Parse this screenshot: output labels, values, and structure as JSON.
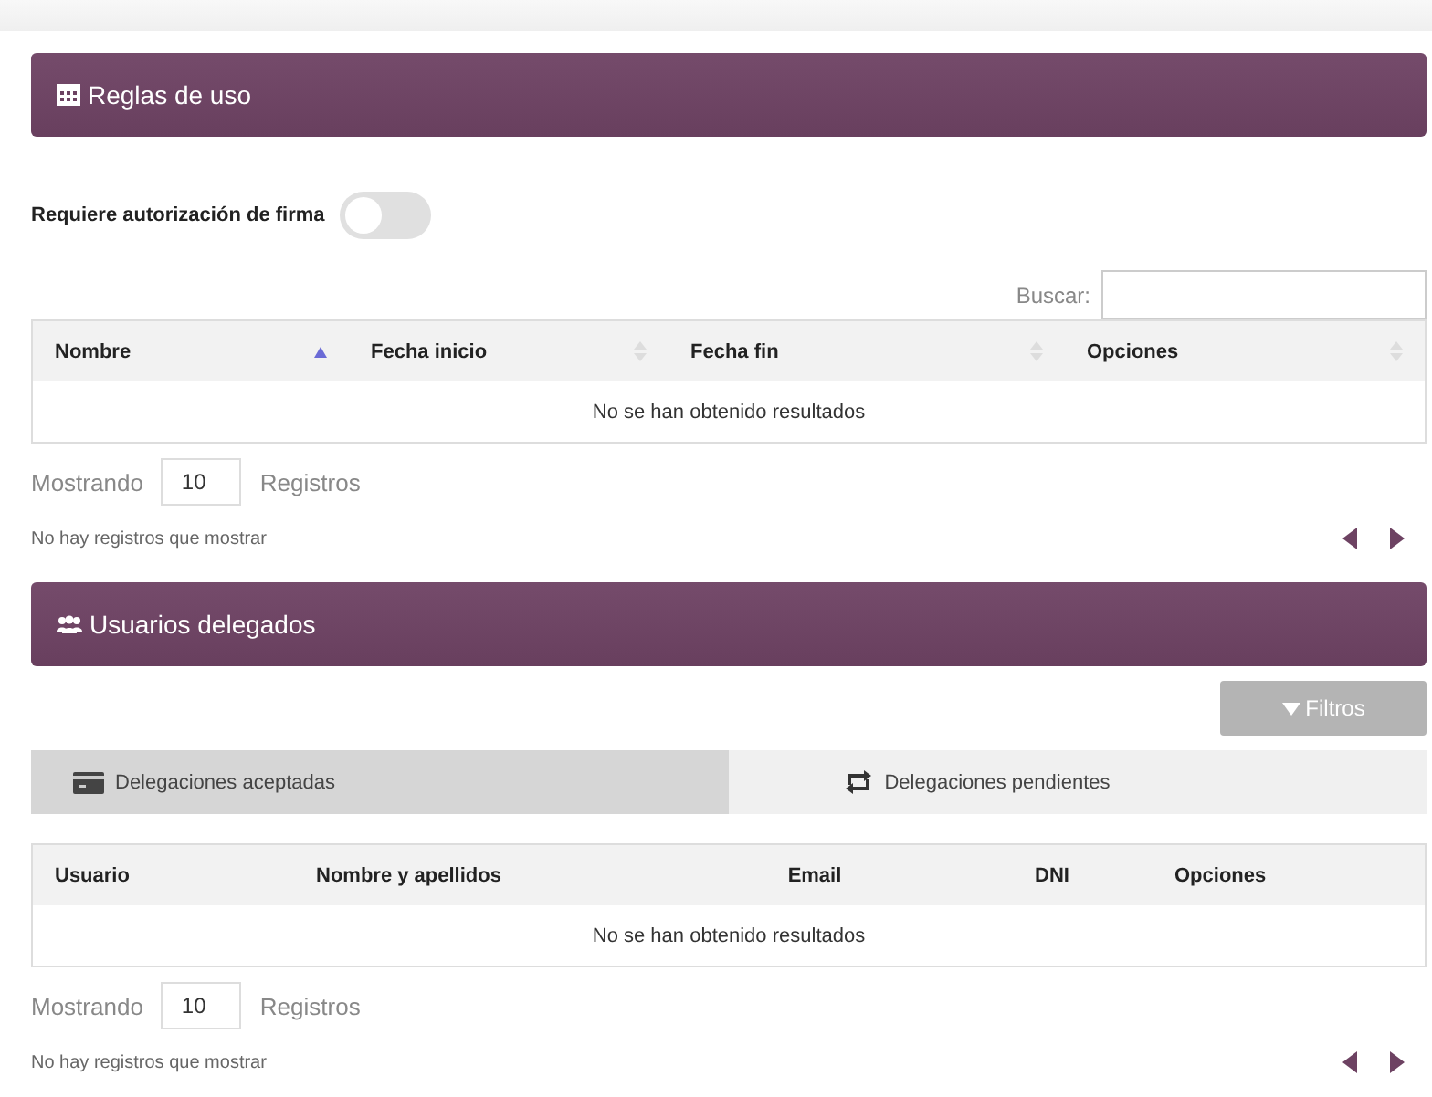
{
  "sections": [
    {
      "kind": "rules",
      "title": "Reglas de uso",
      "toggle": {
        "label": "Requiere autorización de firma",
        "on": false
      },
      "search": {
        "label": "Buscar:"
      },
      "table": {
        "columns": [
          {
            "label": "Nombre",
            "sorted": true
          },
          {
            "label": "Fecha inicio",
            "sorted": false
          },
          {
            "label": "Fecha fin",
            "sorted": false
          },
          {
            "label": "Opciones",
            "sorted": false
          }
        ],
        "empty": "No se han obtenido resultados"
      },
      "length": {
        "prefix": "Mostrando",
        "value": "10",
        "suffix": "Registros"
      },
      "info": "No hay registros que mostrar"
    },
    {
      "kind": "delegates",
      "title": "Usuarios delegados",
      "filter_button": "Filtros",
      "tabs": [
        {
          "label": "Delegaciones aceptadas",
          "selected": true
        },
        {
          "label": "Delegaciones pendientes",
          "selected": false
        }
      ],
      "table": {
        "columns": [
          {
            "label": "Usuario"
          },
          {
            "label": "Nombre y apellidos"
          },
          {
            "label": "Email"
          },
          {
            "label": "DNI"
          },
          {
            "label": "Opciones"
          }
        ],
        "empty": "No se han obtenido resultados"
      },
      "length": {
        "prefix": "Mostrando",
        "value": "10",
        "suffix": "Registros"
      },
      "info": "No hay registros que mostrar"
    }
  ]
}
